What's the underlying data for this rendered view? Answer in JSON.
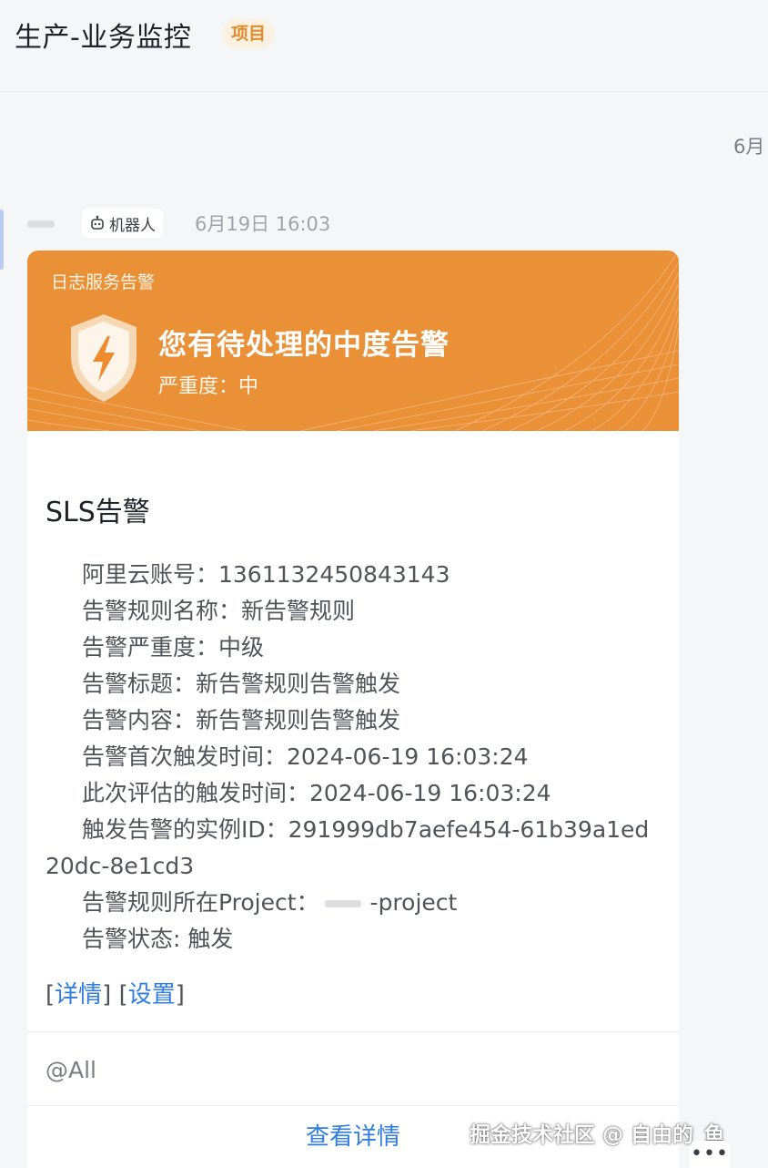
{
  "header": {
    "title": "生产-业务监控",
    "tag": "项目"
  },
  "date_separator": "6月",
  "message": {
    "bot_label": "机器人",
    "time": "6月19日 16:03"
  },
  "card": {
    "source": "日志服务告警",
    "headline": "您有待处理的中度告警",
    "severity": "严重度：中",
    "accent_color": "#ea9037",
    "heading": "SLS告警",
    "items": [
      "阿里云账号：1361132450843143",
      "告警规则名称：新告警规则",
      "告警严重度：中级",
      "告警标题：新告警规则告警触发",
      "告警内容：新告警规则告警触发",
      "告警首次触发时间：2024-06-19 16:03:24",
      "此次评估的触发时间：2024-06-19 16:03:24",
      "触发告警的实例ID：291999db7aefe454-61b39a1ed20dc-8e1cd3"
    ],
    "project_label": "告警规则所在Project：",
    "project_suffix": "-project",
    "status_item": "告警状态: 触发",
    "link_detail": "详情",
    "link_settings": "设置",
    "mention": "@All",
    "view_button": "查看详情"
  },
  "watermark": "掘金技术社区 @ 自由的_鱼",
  "more_button": "•••"
}
